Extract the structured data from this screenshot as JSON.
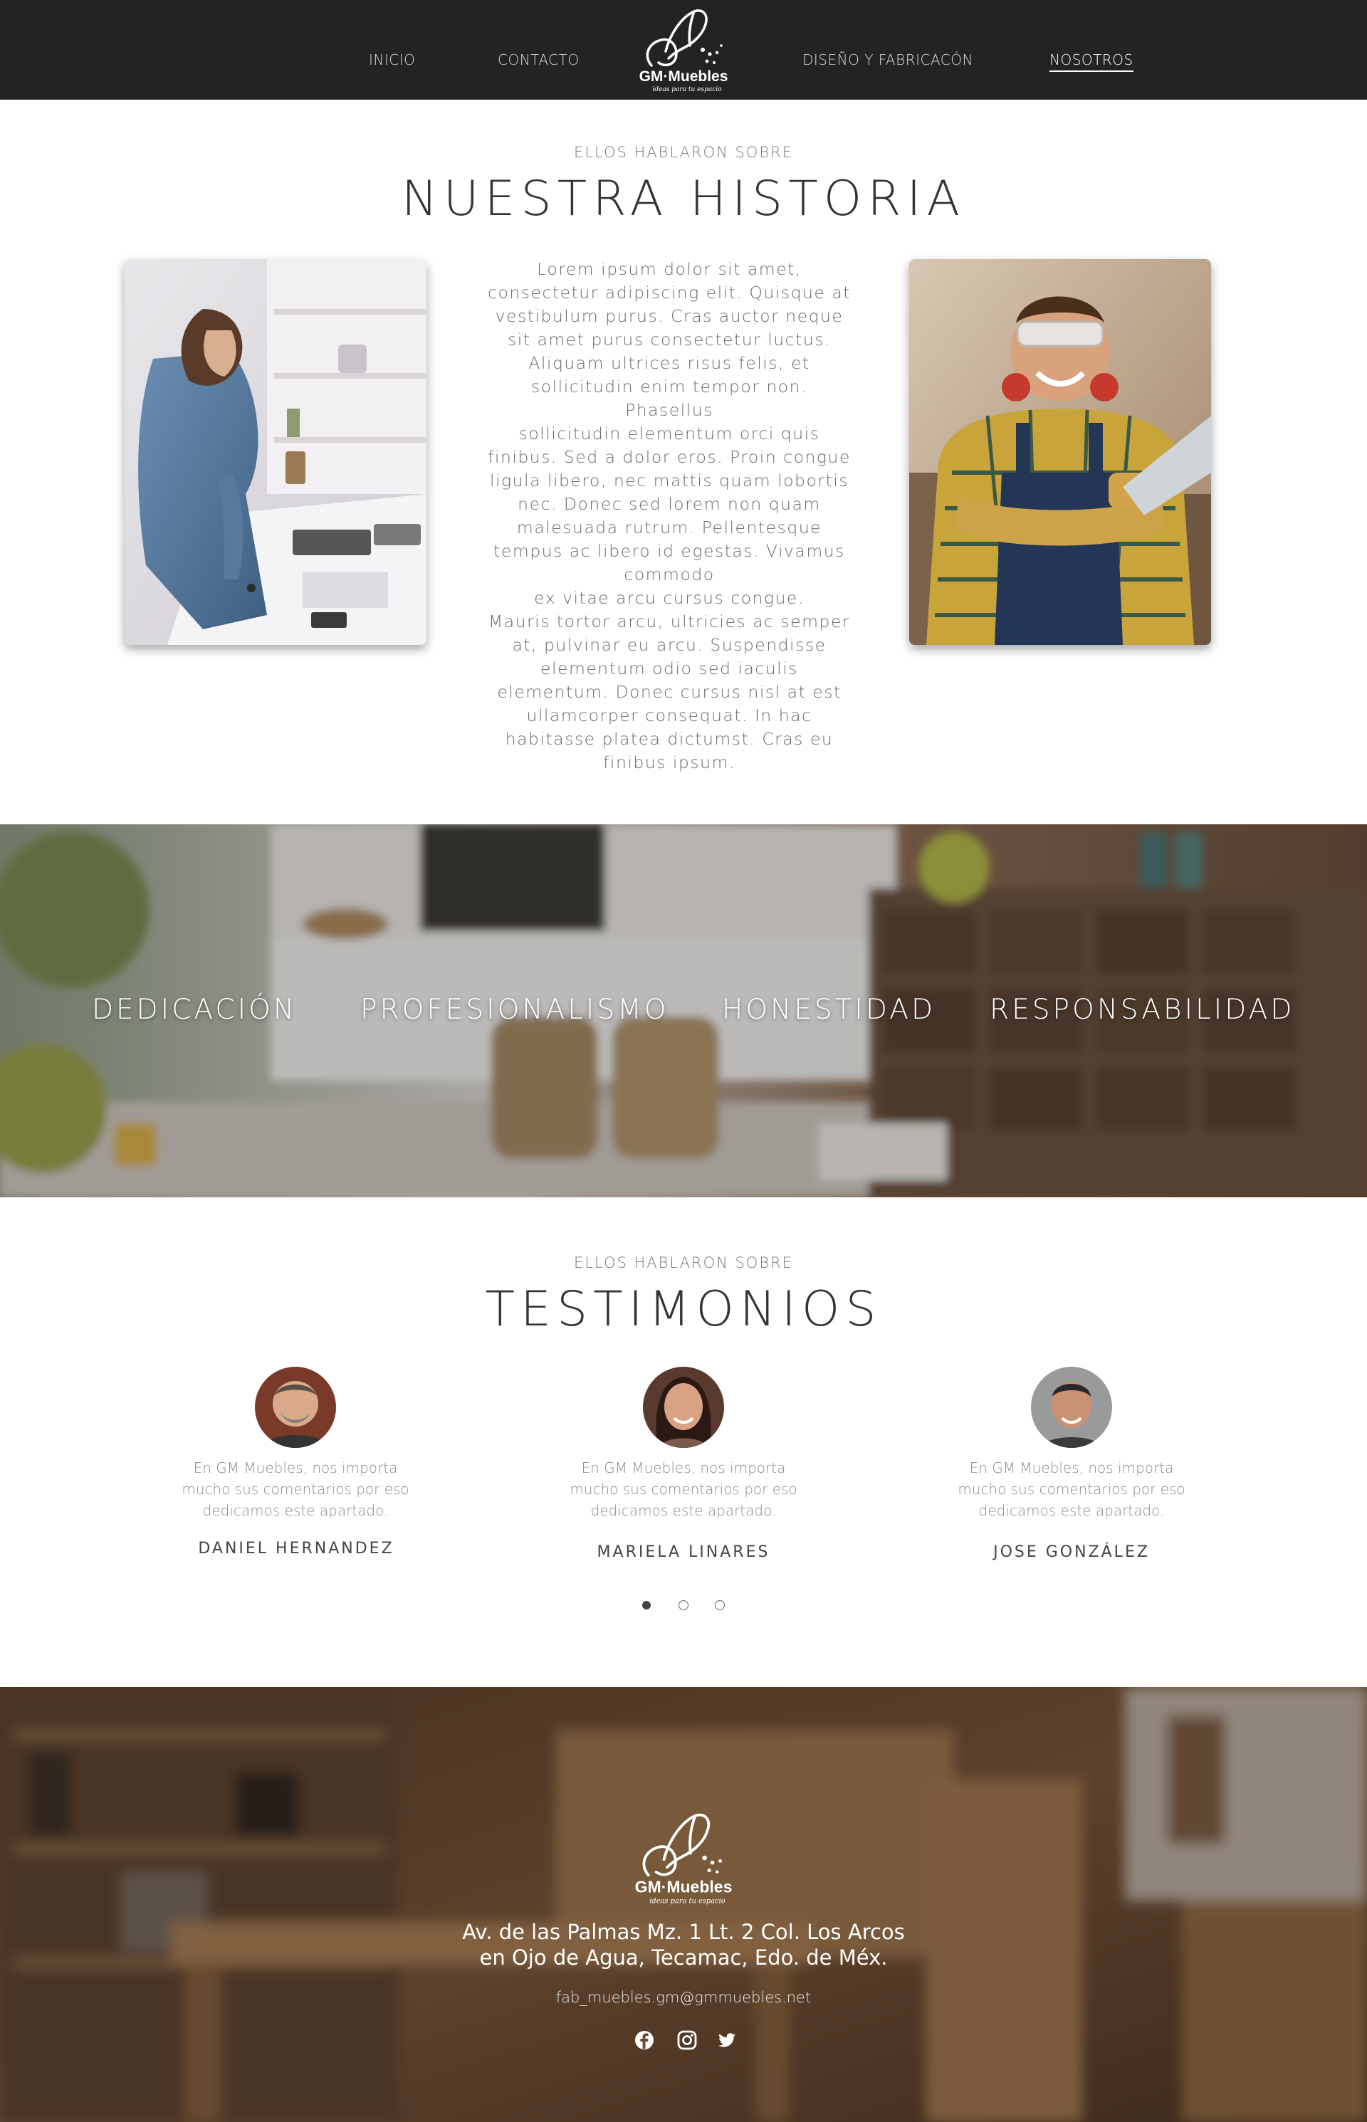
{
  "brand": {
    "name": "GM·Muebles",
    "tagline": "ideas para tu espacio"
  },
  "nav": {
    "items": [
      {
        "label": "INICIO"
      },
      {
        "label": "CONTACTO"
      },
      {
        "label": "DISEÑO Y FABRICACÓN"
      },
      {
        "label": "NOSOTROS",
        "active": true
      }
    ]
  },
  "history": {
    "eyebrow": "ELLOS HABLARON SOBRE",
    "title": "NUESTRA HISTORIA",
    "lines": [
      "Lorem ipsum dolor sit amet,",
      "consectetur adipiscing elit. Quisque at",
      "vestibulum purus. Cras auctor neque",
      "sit amet purus consectetur luctus.",
      "Aliquam ultrices risus felis, et",
      "sollicitudin enim tempor non. Phasellus",
      "sollicitudin elementum orci quis",
      "finibus. Sed a dolor eros. Proin congue",
      "ligula libero, nec mattis quam lobortis",
      "nec. Donec sed lorem non quam",
      "malesuada rutrum. Pellentesque",
      "tempus ac libero id egestas. Vivamus",
      "commodo",
      "ex vitae arcu cursus congue.",
      "Mauris tortor arcu, ultricies ac semper",
      "at, pulvinar eu arcu. Suspendisse",
      "elementum odio sed iaculis",
      "elementum. Donec cursus nisl at est",
      "ullamcorper consequat. In hac",
      "habitasse platea dictumst. Cras eu",
      "finibus ipsum."
    ]
  },
  "values": {
    "items": [
      "DEDICACIÓN",
      "PROFESIONALISMO",
      "HONESTIDAD",
      "RESPONSABILIDAD"
    ]
  },
  "testimonials": {
    "eyebrow": "ELLOS HABLARON SOBRE",
    "title": "TESTIMONIOS",
    "quote_lines": [
      "En GM Muebles, nos importa",
      "mucho sus comentarios por eso",
      "dedicamos  este apartado."
    ],
    "people": [
      {
        "name": "DANIEL HERNANDEZ"
      },
      {
        "name": "MARIELA LINARES"
      },
      {
        "name": "JOSE GONZÁLEZ"
      }
    ],
    "carousel": {
      "pages": 3,
      "active_index": 0
    }
  },
  "footer": {
    "address_line1": "Av. de las Palmas Mz. 1 Lt. 2 Col. Los Arcos",
    "address_line2": "en Ojo de Agua, Tecamac, Edo. de Méx.",
    "email": "fab_muebles.gm@gmmuebles.net",
    "social": [
      "facebook-icon",
      "instagram-icon",
      "twitter-icon"
    ]
  },
  "colors": {
    "nav_bg": "#232323",
    "text_dark": "#333333",
    "text_muted": "#777777"
  }
}
